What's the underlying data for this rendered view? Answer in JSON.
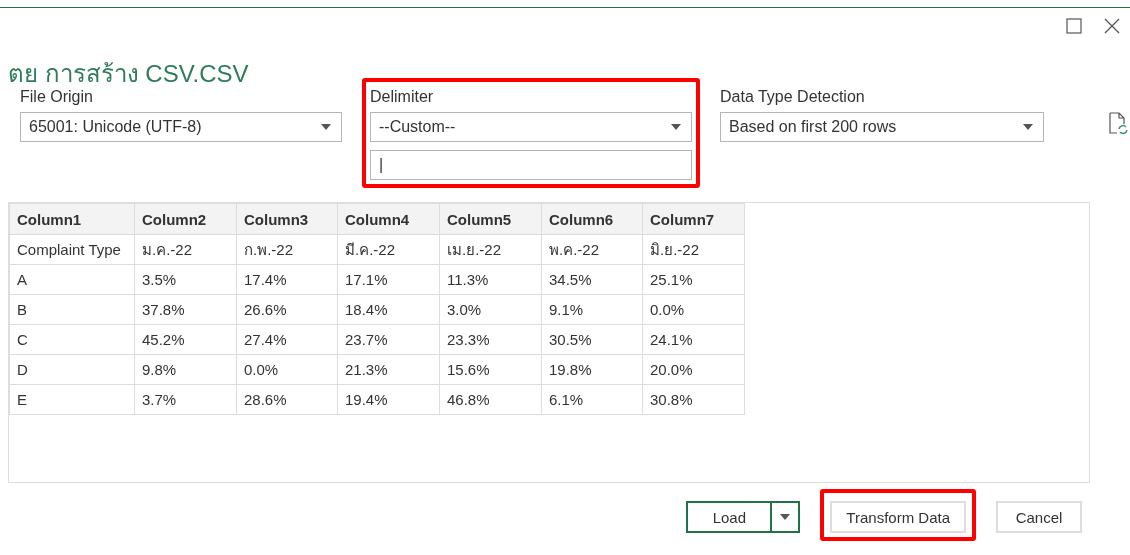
{
  "window": {
    "title": "ตย การสร้าง CSV.CSV"
  },
  "fields": [
    {
      "label": "File Origin",
      "value": "65001: Unicode (UTF-8)",
      "highlighted": false
    },
    {
      "label": "Delimiter",
      "value": "--Custom--",
      "custom_value": "|",
      "highlighted": true
    },
    {
      "label": "Data Type Detection",
      "value": "Based on first 200 rows",
      "highlighted": false
    }
  ],
  "table": {
    "columns": [
      "Column1",
      "Column2",
      "Column3",
      "Column4",
      "Column5",
      "Column6",
      "Column7"
    ],
    "rows": [
      [
        "Complaint Type",
        "ม.ค.-22",
        "ก.พ.-22",
        "มี.ค.-22",
        "เม.ย.-22",
        "พ.ค.-22",
        "มิ.ย.-22"
      ],
      [
        "A",
        "3.5%",
        "17.4%",
        "17.1%",
        "11.3%",
        "34.5%",
        "25.1%"
      ],
      [
        "B",
        "37.8%",
        "26.6%",
        "18.4%",
        "3.0%",
        "9.1%",
        "0.0%"
      ],
      [
        "C",
        "45.2%",
        "27.4%",
        "23.7%",
        "23.3%",
        "30.5%",
        "24.1%"
      ],
      [
        "D",
        "9.8%",
        "0.0%",
        "21.3%",
        "15.6%",
        "19.8%",
        "20.0%"
      ],
      [
        "E",
        "3.7%",
        "28.6%",
        "19.4%",
        "46.8%",
        "6.1%",
        "30.8%"
      ]
    ]
  },
  "buttons": [
    {
      "label": "Load",
      "kind": "split",
      "highlighted": false
    },
    {
      "label": "Transform Data",
      "kind": "plain",
      "highlighted": true
    },
    {
      "label": "Cancel",
      "kind": "plain",
      "highlighted": false
    }
  ]
}
